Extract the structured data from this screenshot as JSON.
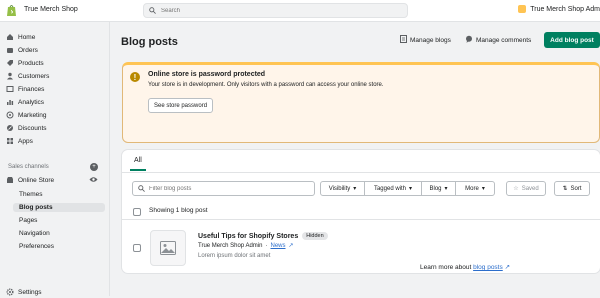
{
  "store": {
    "name": "True Merch Shop"
  },
  "search": {
    "placeholder": "Search"
  },
  "user": {
    "name": "True Merch Shop Adm"
  },
  "nav": [
    {
      "label": "Home",
      "icon": "home-icon"
    },
    {
      "label": "Orders",
      "icon": "orders-icon"
    },
    {
      "label": "Products",
      "icon": "products-icon"
    },
    {
      "label": "Customers",
      "icon": "customers-icon"
    },
    {
      "label": "Finances",
      "icon": "finances-icon"
    },
    {
      "label": "Analytics",
      "icon": "analytics-icon"
    },
    {
      "label": "Marketing",
      "icon": "marketing-icon"
    },
    {
      "label": "Discounts",
      "icon": "discounts-icon"
    },
    {
      "label": "Apps",
      "icon": "apps-icon"
    }
  ],
  "sales_channels": {
    "label": "Sales channels",
    "online_store": "Online Store",
    "sub": [
      "Themes",
      "Blog posts",
      "Pages",
      "Navigation",
      "Preferences"
    ]
  },
  "settings_label": "Settings",
  "page": {
    "title": "Blog posts",
    "manage_blogs": "Manage blogs",
    "manage_comments": "Manage comments",
    "add_blog_post": "Add blog post"
  },
  "banner": {
    "title": "Online store is password protected",
    "desc": "Your store is in development. Only visitors with a password can access your online store.",
    "button": "See store password"
  },
  "tabs": {
    "all": "All"
  },
  "filters": {
    "placeholder": "Filter blog posts",
    "visibility": "Visibility",
    "tagged_with": "Tagged with",
    "blog": "Blog",
    "more": "More",
    "saved": "Saved",
    "sort": "Sort"
  },
  "list": {
    "showing": "Showing 1 blog post"
  },
  "post": {
    "title": "Useful Tips for Shopify Stores",
    "status": "Hidden",
    "author": "True Merch Shop Admin",
    "blog": "News",
    "excerpt": "Lorem ipsum dolor sit amet"
  },
  "footer": {
    "learn_prefix": "Learn more about",
    "learn_link": "blog posts"
  },
  "colors": {
    "primary": "#008060",
    "banner_bg": "#fff5ea",
    "banner_border": "#ffc453"
  }
}
